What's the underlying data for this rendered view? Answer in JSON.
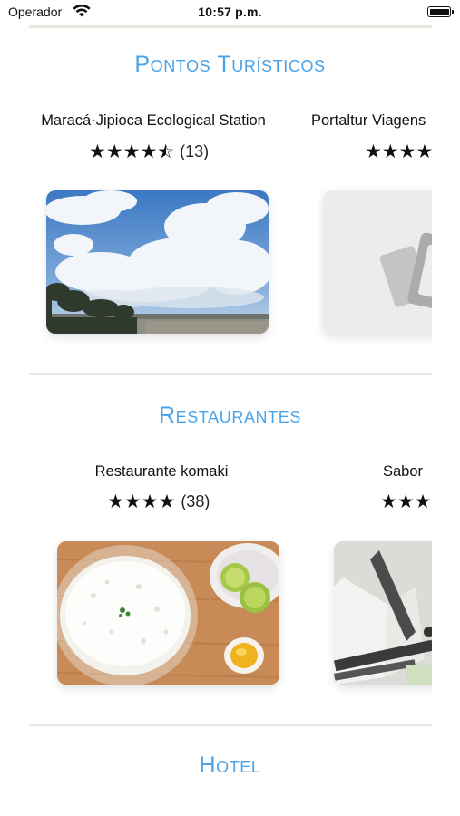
{
  "status_bar": {
    "carrier": "Operador",
    "time": "10:57 p.m."
  },
  "sections": {
    "pontos": {
      "title": "Pontos Turísticos",
      "cards": [
        {
          "name": "Maracá-Jipioca Ecological Station",
          "stars_full": "★★★★",
          "stars_half": "☆",
          "count": "(13)",
          "rating": 4.5
        },
        {
          "name": "Portaltur Viagens",
          "stars_full": "★★★★",
          "count": ""
        }
      ]
    },
    "restaurantes": {
      "title": "Restaurantes",
      "cards": [
        {
          "name": "Restaurante komaki",
          "stars_full": "★★★★",
          "count": "(38)",
          "rating": 4
        },
        {
          "name": "Sabor",
          "stars_full": "★★★",
          "count": ""
        }
      ]
    },
    "hotel": {
      "title": "Hotel"
    }
  },
  "colors": {
    "accent": "#4aa3e8",
    "divider": "#ece6e1"
  }
}
